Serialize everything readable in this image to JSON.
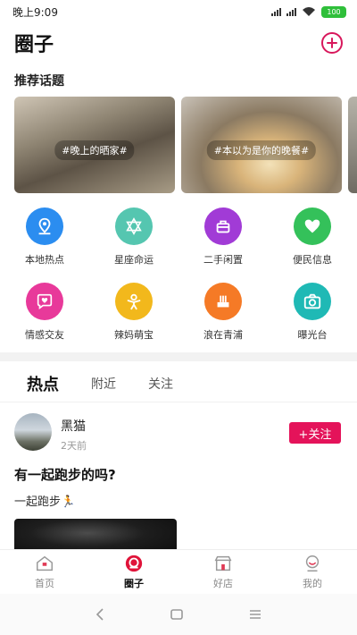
{
  "status_bar": {
    "time": "晚上9:09",
    "battery": "100"
  },
  "header": {
    "title": "圈子"
  },
  "recommend": {
    "title": "推荐话题",
    "topics": [
      {
        "label": "#晚上的晒家#"
      },
      {
        "label": "#本以为是你的晚餐#"
      }
    ]
  },
  "categories": [
    {
      "label": "本地热点",
      "icon": "location-pin-icon",
      "color": "#2b8df0"
    },
    {
      "label": "星座命运",
      "icon": "star-of-david-icon",
      "color": "#55c6b0"
    },
    {
      "label": "二手闲置",
      "icon": "basket-icon",
      "color": "#a13bd6"
    },
    {
      "label": "便民信息",
      "icon": "heart-icon",
      "color": "#34c15a"
    },
    {
      "label": "情感交友",
      "icon": "chat-heart-icon",
      "color": "#e8399a"
    },
    {
      "label": "辣妈萌宝",
      "icon": "baby-icon",
      "color": "#f2b81c"
    },
    {
      "label": "浪在青浦",
      "icon": "fork-icon",
      "color": "#f57a26"
    },
    {
      "label": "曝光台",
      "icon": "camera-icon",
      "color": "#1fb9b5"
    }
  ],
  "tabs": [
    {
      "label": "热点"
    },
    {
      "label": "附近"
    },
    {
      "label": "关注"
    }
  ],
  "post": {
    "user": "黑猫",
    "time": "2天前",
    "follow_label": "+关注",
    "title": "有一起跑步的吗?",
    "body": "一起跑步🏃"
  },
  "bottom_nav": [
    {
      "label": "首页",
      "icon": "home-icon"
    },
    {
      "label": "圈子",
      "icon": "circle-icon"
    },
    {
      "label": "好店",
      "icon": "shop-icon"
    },
    {
      "label": "我的",
      "icon": "profile-icon"
    }
  ],
  "colors": {
    "accent": "#e4135a",
    "battery": "#2fbf3a"
  }
}
